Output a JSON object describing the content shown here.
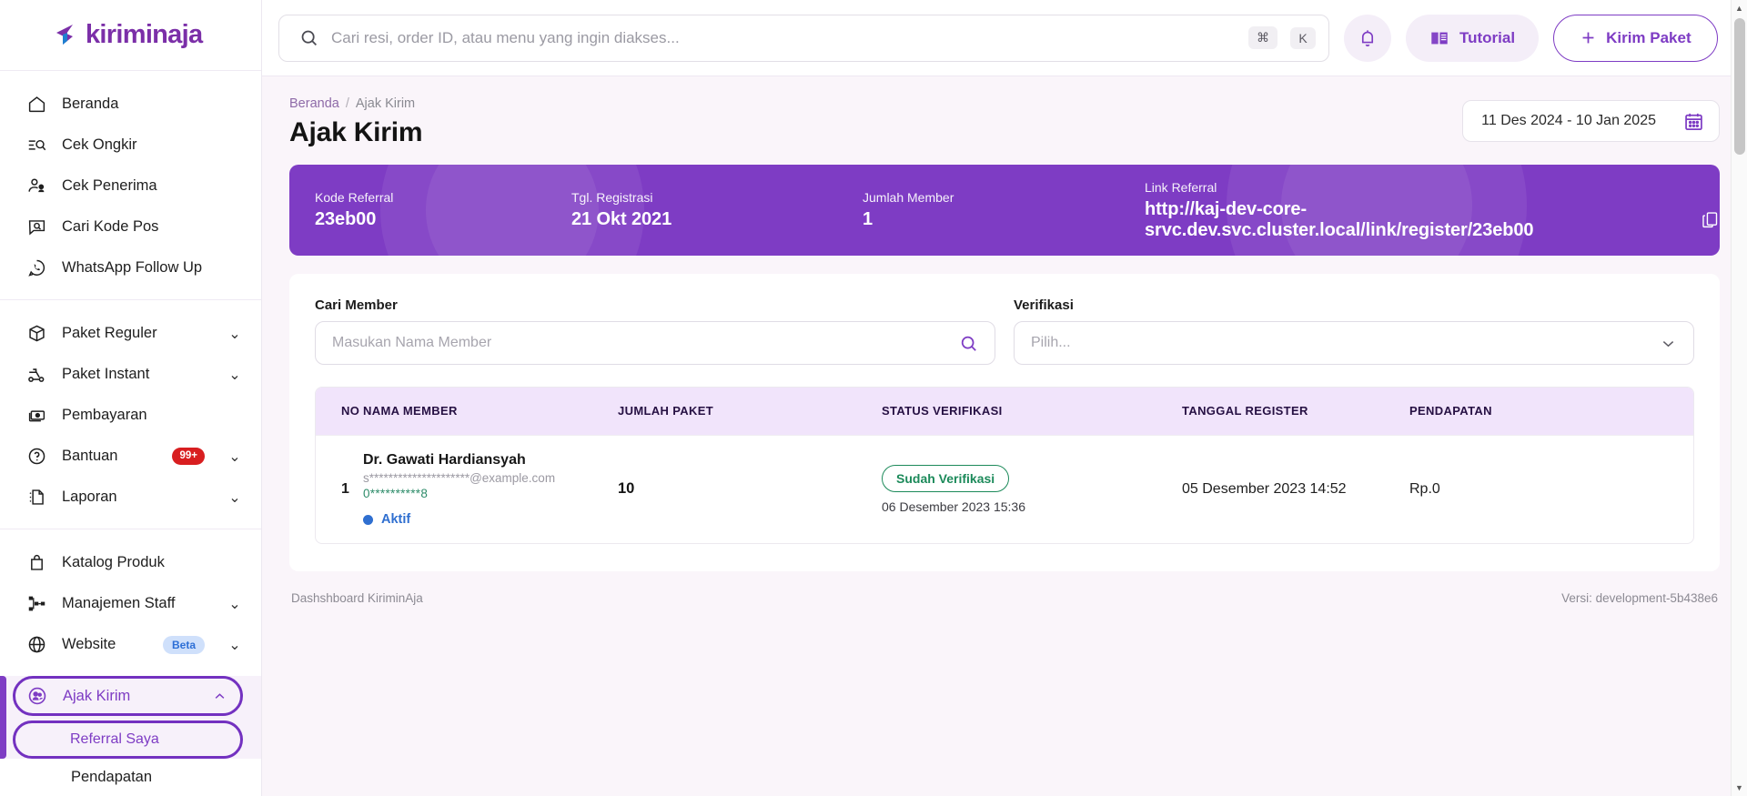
{
  "brand": {
    "logo_text": "kiriminaja"
  },
  "topbar": {
    "search_placeholder": "Cari resi, order ID, atau menu yang ingin diakses...",
    "kbd_cmd": "⌘",
    "kbd_key": "K",
    "tutorial_label": "Tutorial",
    "kirim_paket_label": "Kirim Paket",
    "kirim_paket_plus": "+"
  },
  "sidebar": {
    "group1": [
      {
        "label": "Beranda",
        "icon": "home-icon"
      },
      {
        "label": "Cek Ongkir",
        "icon": "price-search-icon"
      },
      {
        "label": "Cek Penerima",
        "icon": "person-check-icon"
      },
      {
        "label": "Cari Kode Pos",
        "icon": "postal-search-icon"
      },
      {
        "label": "WhatsApp Follow Up",
        "icon": "whatsapp-icon"
      }
    ],
    "group2": [
      {
        "label": "Paket Reguler",
        "icon": "box-icon",
        "chevron": "⌄"
      },
      {
        "label": "Paket Instant",
        "icon": "scooter-icon",
        "chevron": "⌄"
      },
      {
        "label": "Pembayaran",
        "icon": "money-icon",
        "chevron": ""
      },
      {
        "label": "Bantuan",
        "icon": "help-circle-icon",
        "badge": "99+",
        "chevron": "⌄"
      },
      {
        "label": "Laporan",
        "icon": "report-icon",
        "chevron": "⌄"
      }
    ],
    "group3": [
      {
        "label": "Katalog Produk",
        "icon": "bag-icon",
        "chevron": ""
      },
      {
        "label": "Manajemen Staff",
        "icon": "org-chart-icon",
        "chevron": "⌄"
      },
      {
        "label": "Website",
        "icon": "globe-icon",
        "badge": "Beta",
        "chevron": "⌄"
      }
    ],
    "active": {
      "parent_label": "Ajak Kirim",
      "parent_icon": "people-circle-icon",
      "parent_chevron": "⌃",
      "sub_label": "Referral Saya",
      "sub2_label": "Pendapatan"
    }
  },
  "breadcrumb": {
    "first": "Beranda",
    "separator": "/",
    "second": "Ajak Kirim"
  },
  "page": {
    "title": "Ajak Kirim"
  },
  "daterange": {
    "value": "11 Des 2024 - 10 Jan 2025",
    "icon": "calendar-icon"
  },
  "banner": {
    "kode_referral_label": "Kode Referral",
    "kode_referral_value": "23eb00",
    "tgl_registrasi_label": "Tgl. Registrasi",
    "tgl_registrasi_value": "21 Okt 2021",
    "jumlah_member_label": "Jumlah Member",
    "jumlah_member_value": "1",
    "link_referral_label": "Link Referral",
    "link_referral_value": "http://kaj-dev-core-srvc.dev.svc.cluster.local/link/register/23eb00",
    "copy_icon": "copy-icon",
    "bg_color": "#7e3cc4"
  },
  "filters": {
    "cari_member_label": "Cari Member",
    "cari_member_placeholder": "Masukan Nama Member",
    "search_icon": "search-icon",
    "verifikasi_label": "Verifikasi",
    "verifikasi_placeholder": "Pilih...",
    "verifikasi_icon": "chevron-down-icon"
  },
  "table": {
    "headers": [
      "NO",
      "NAMA MEMBER",
      "JUMLAH PAKET",
      "STATUS VERIFIKASI",
      "TANGGAL REGISTER",
      "PENDAPATAN"
    ],
    "rows": [
      {
        "no": "1",
        "nama": "Dr. Gawati Hardiansyah",
        "email": "s*********************@example.com",
        "phone": "0**********8",
        "member_status": "Aktif",
        "jumlah_paket": "10",
        "status_verifikasi": "Sudah Verifikasi",
        "verifikasi_date": "06 Desember 2023 15:36",
        "tanggal_register": "05 Desember 2023 14:52",
        "pendapatan": "Rp.0"
      }
    ]
  },
  "footer": {
    "left": "Dashshboard KiriminAja",
    "right": "Versi: development-5b438e6"
  },
  "colors": {
    "brand_purple": "#7e3cc4",
    "logo_purple": "#7b2fa8",
    "banner_purple": "#7e3cc4",
    "table_header_bg": "#f1e4fb",
    "verified_green": "#1c8a5a",
    "active_blue": "#2f6fd0",
    "badge_red": "#d81e20",
    "beta_blue": "#2d6fd6"
  }
}
